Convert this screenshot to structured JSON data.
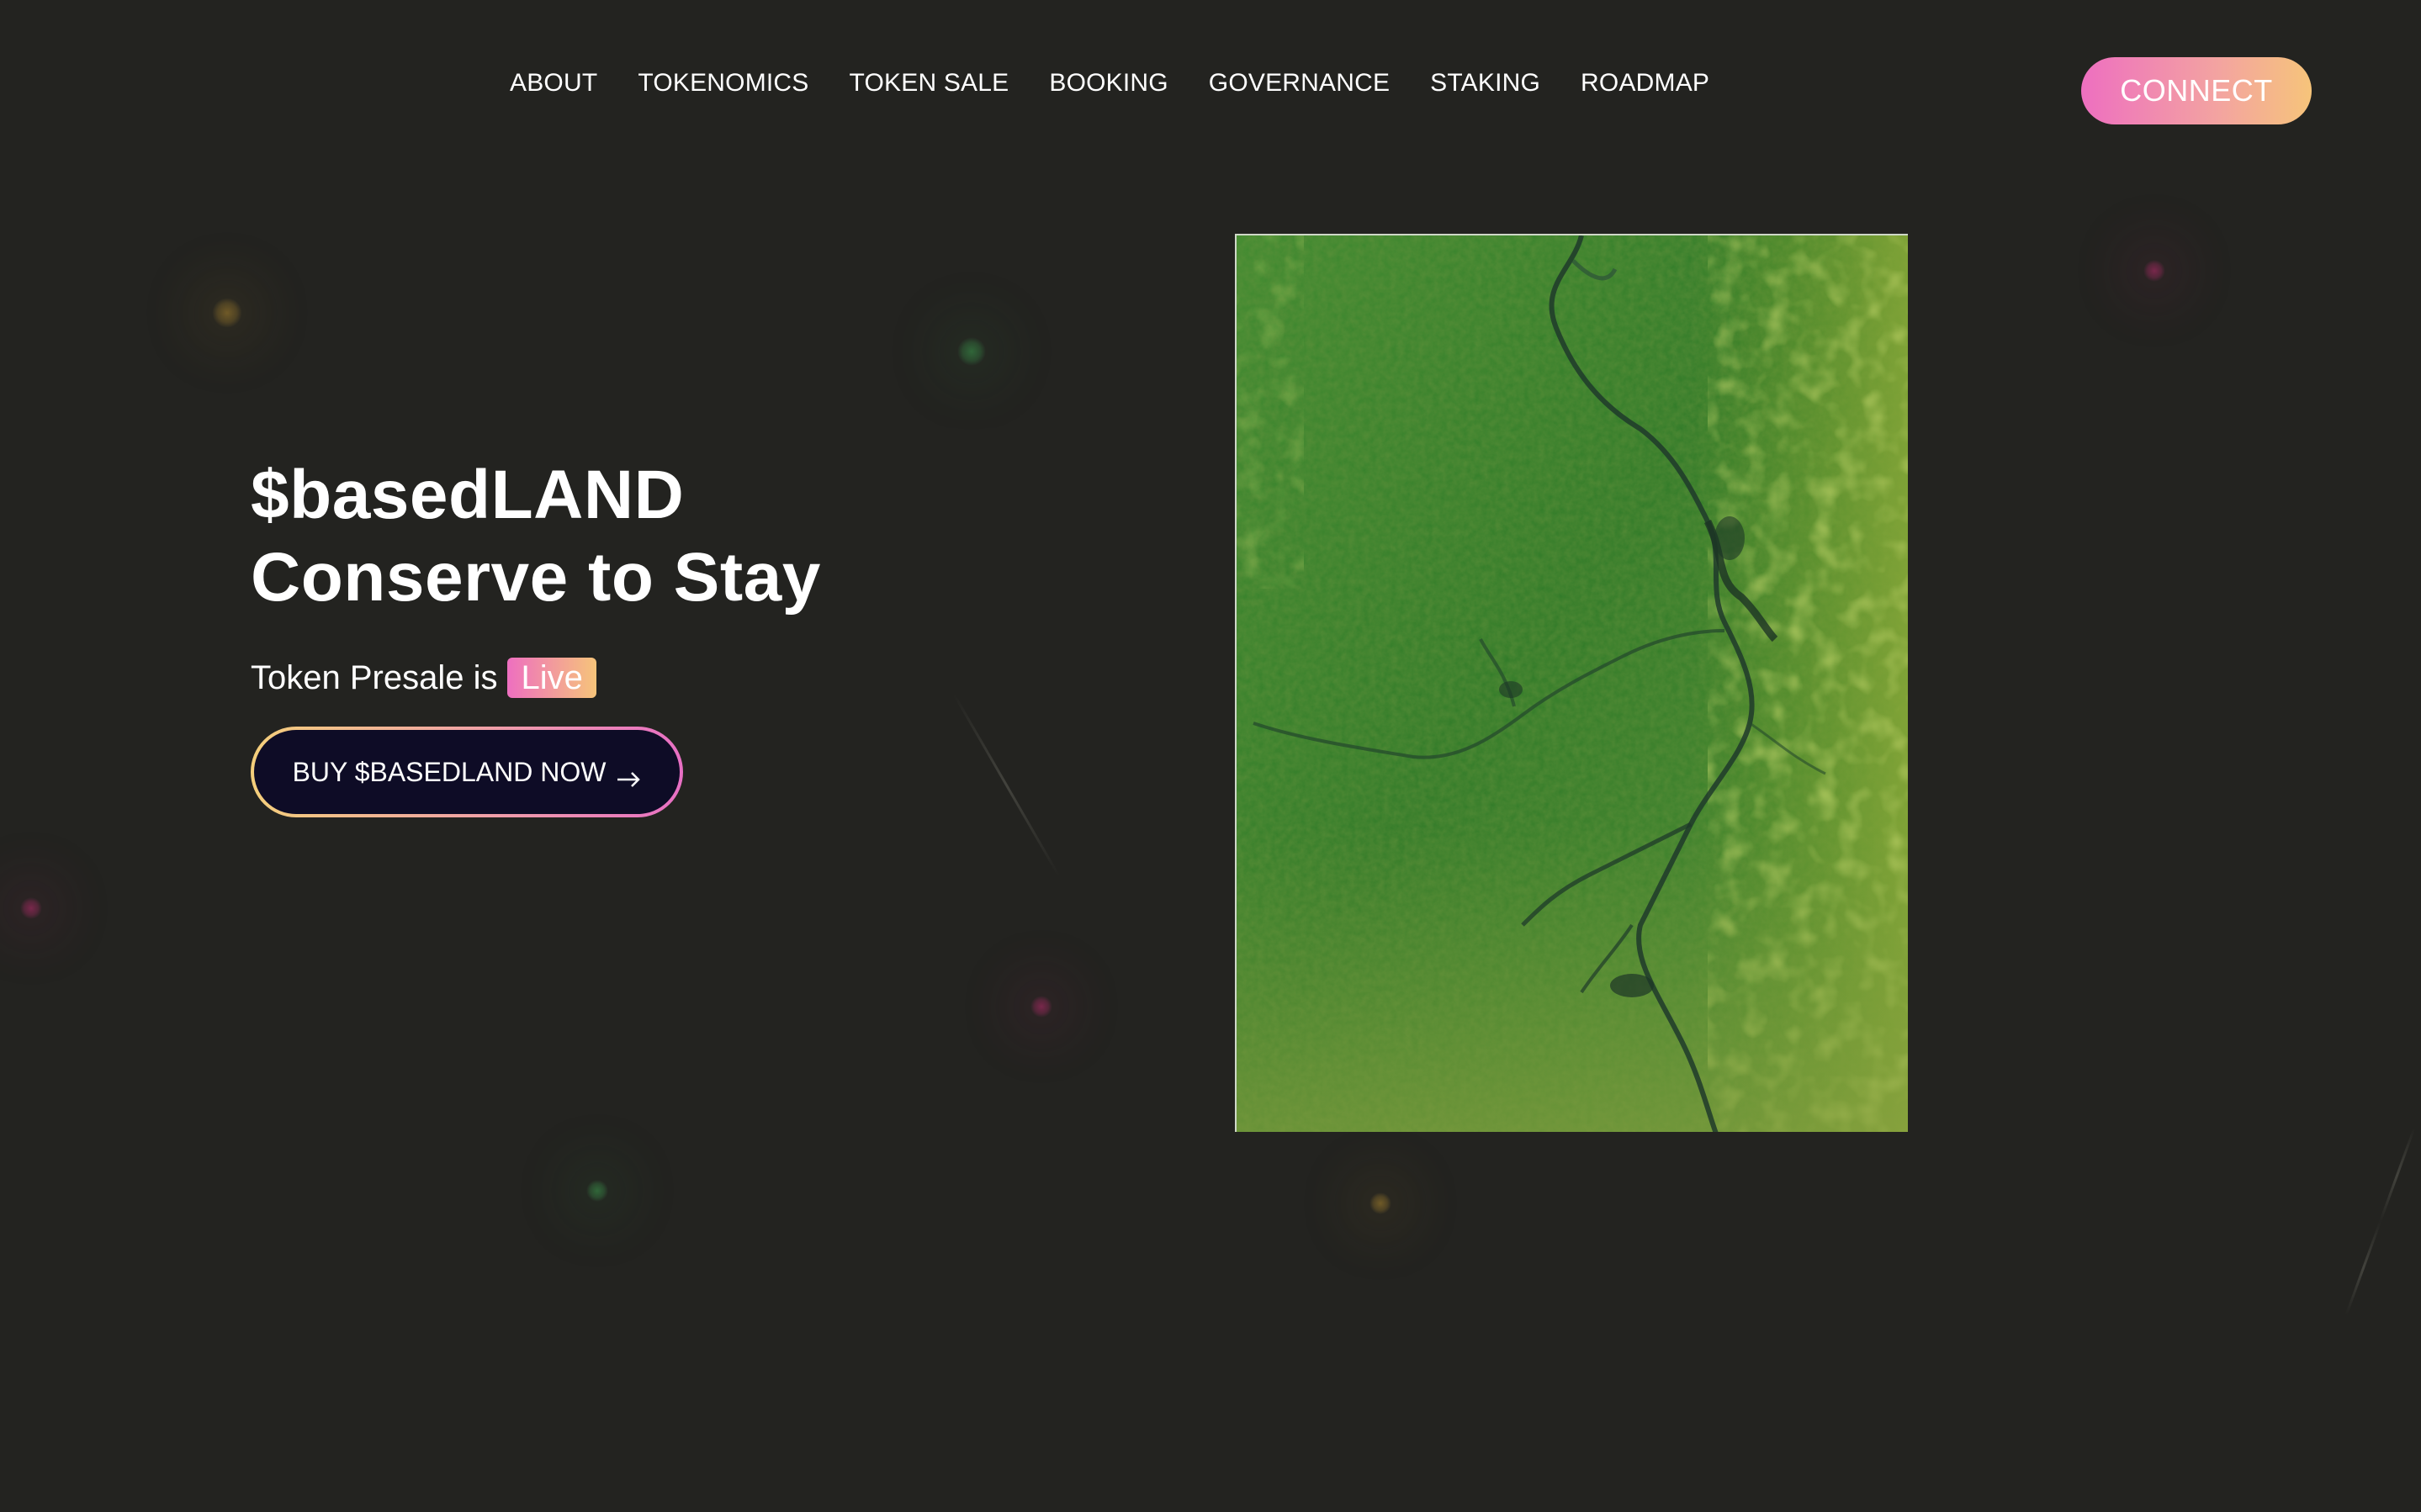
{
  "nav": {
    "items": [
      {
        "label": "ABOUT"
      },
      {
        "label": "TOKENOMICS"
      },
      {
        "label": "TOKEN SALE"
      },
      {
        "label": "BOOKING"
      },
      {
        "label": "GOVERNANCE"
      },
      {
        "label": "STAKING"
      },
      {
        "label": "ROADMAP"
      }
    ],
    "connect_label": "CONNECT"
  },
  "hero": {
    "title_line1": "$basedLAND",
    "title_line2": "Conserve to Stay",
    "presale_text": "Token Presale is",
    "live_badge": "Live",
    "buy_label": "BUY $BASEDLAND NOW",
    "buy_icon": "arrow-right-icon"
  },
  "image": {
    "subject": "aerial view of green marshland with winding streams"
  },
  "colors": {
    "background": "#232320",
    "accent_pink": "#ee6fc0",
    "accent_gold": "#f6c47a",
    "button_dark": "#0e0c26"
  }
}
